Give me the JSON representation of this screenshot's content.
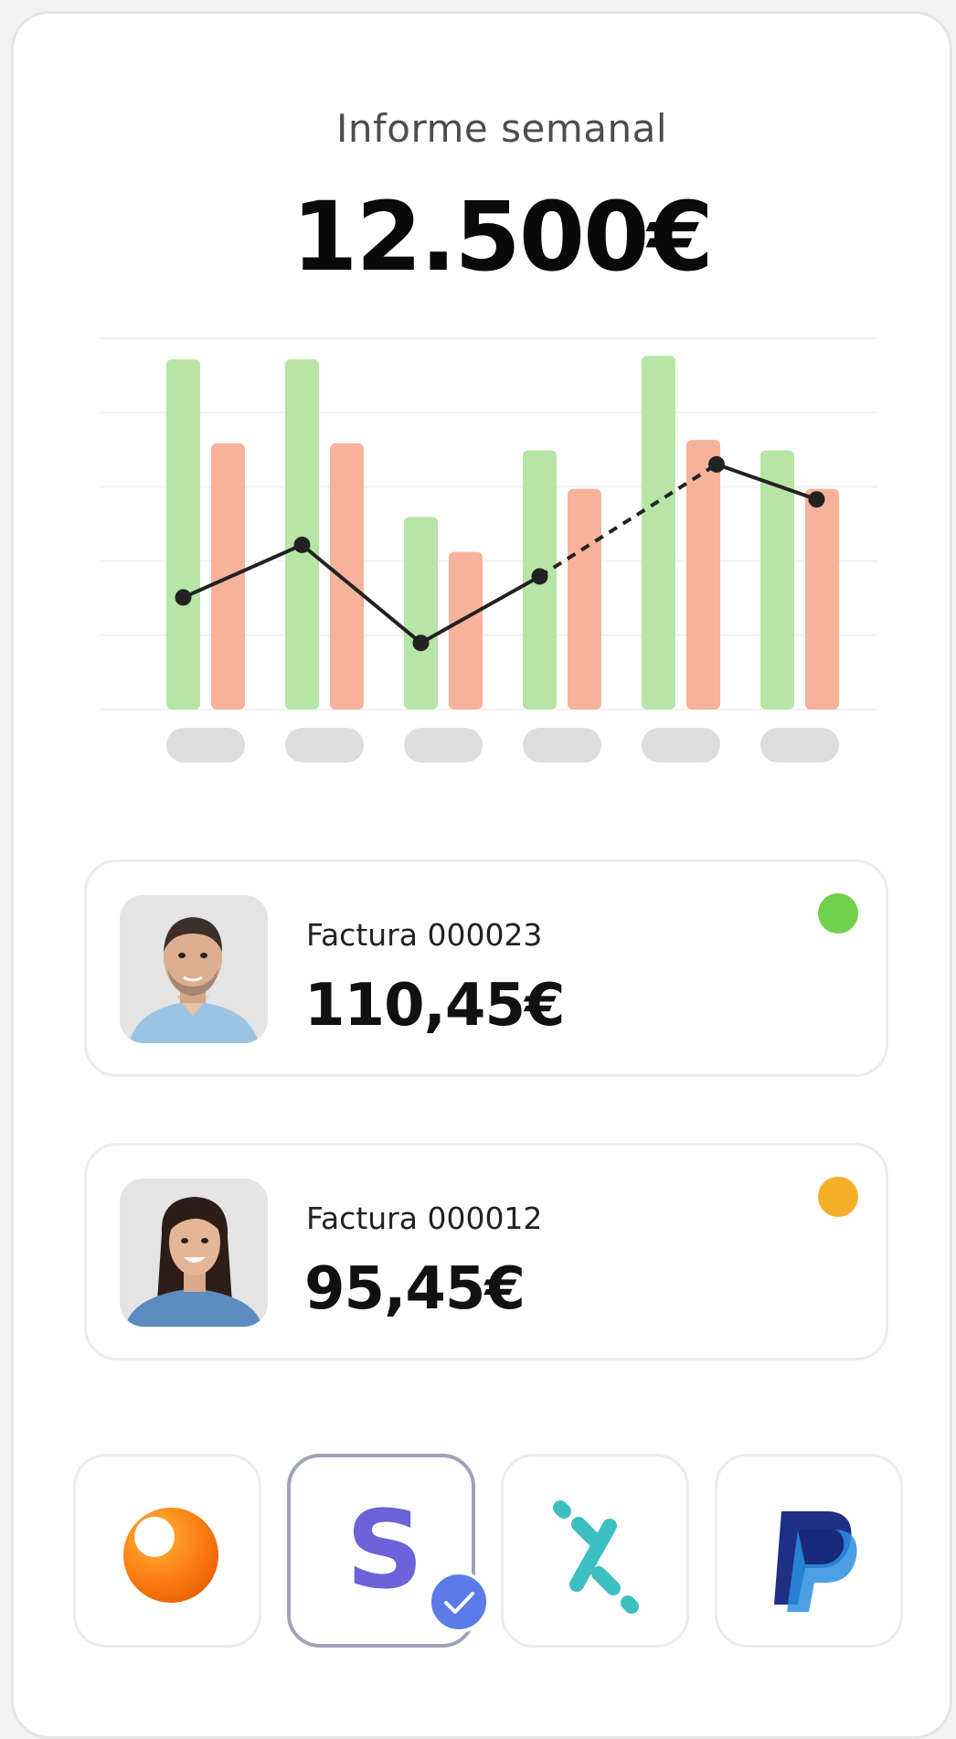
{
  "header": {
    "title": "Informe semanal",
    "total": "12.500€"
  },
  "chart_data": {
    "type": "bar",
    "categories": [
      "",
      "",
      "",
      "",
      "",
      ""
    ],
    "series": [
      {
        "values": [
          100,
          100,
          55,
          74,
          101,
          74
        ],
        "color": "#b6e5a6"
      },
      {
        "values": [
          76,
          76,
          45,
          63,
          77,
          63
        ],
        "color": "#f6b29b"
      }
    ],
    "line": {
      "values": [
        32,
        47,
        19,
        38,
        70,
        60
      ],
      "dashed_segment": [
        3,
        4
      ],
      "color": "#222222"
    },
    "ylim": [
      0,
      106
    ],
    "grid": true,
    "tick_label_placeholder_color": "#dddddd"
  },
  "invoices": [
    {
      "label": "Factura 000023",
      "amount": "110,45€",
      "status_color": "#6fd14c",
      "avatar": "man-avatar"
    },
    {
      "label": "Factura 000012",
      "amount": "95,45€",
      "status_color": "#f5ae2a",
      "avatar": "woman-avatar"
    }
  ],
  "payment_methods": [
    {
      "icon": "orange-sphere-logo-icon",
      "selected": false
    },
    {
      "icon": "stripe-s-logo-icon",
      "selected": true
    },
    {
      "icon": "percent-logo-icon",
      "selected": false
    },
    {
      "icon": "paypal-logo-icon",
      "selected": false
    }
  ],
  "colors": {
    "accent": "#5b7be8",
    "stripe": "#6b63d8",
    "teal": "#3bbfc0",
    "paypal_dark": "#1f2f85",
    "paypal_light": "#2b8fe0"
  }
}
